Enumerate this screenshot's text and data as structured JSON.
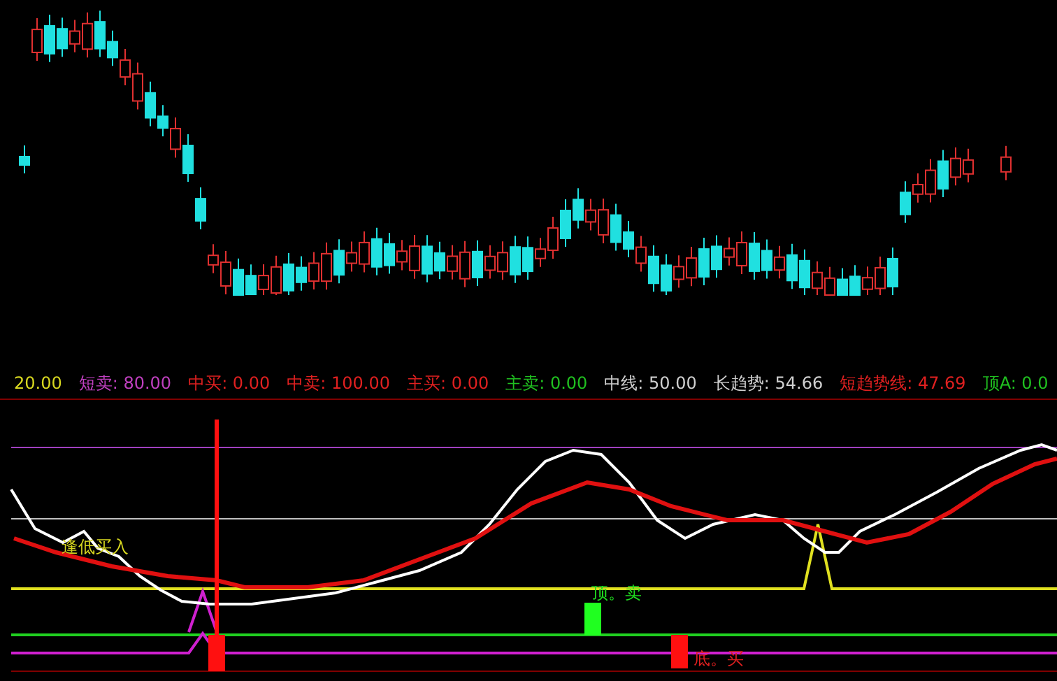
{
  "indicator_header": {
    "items": [
      {
        "text": "20.00",
        "color": "#d8d820"
      },
      {
        "text": "短卖: 80.00",
        "color": "#c040c0"
      },
      {
        "text": "中买: 0.00",
        "color": "#e02020"
      },
      {
        "text": "中卖: 100.00",
        "color": "#e02020"
      },
      {
        "text": "主买: 0.00",
        "color": "#e02020"
      },
      {
        "text": "主卖: 0.00",
        "color": "#20c020"
      },
      {
        "text": "中线: 50.00",
        "color": "#d0d0d0"
      },
      {
        "text": "长趋势: 54.66",
        "color": "#d0d0d0"
      },
      {
        "text": "短趋势线: 47.69",
        "color": "#e02020"
      },
      {
        "text": "顶A: 0.0",
        "color": "#20c020"
      }
    ]
  },
  "indicator_panel": {
    "labels": [
      {
        "text": "逢低买入",
        "color": "#d8d820"
      },
      {
        "text": "顶。卖",
        "color": "#20e020"
      },
      {
        "text": "底。买",
        "color": "#e02020"
      }
    ]
  }
}
